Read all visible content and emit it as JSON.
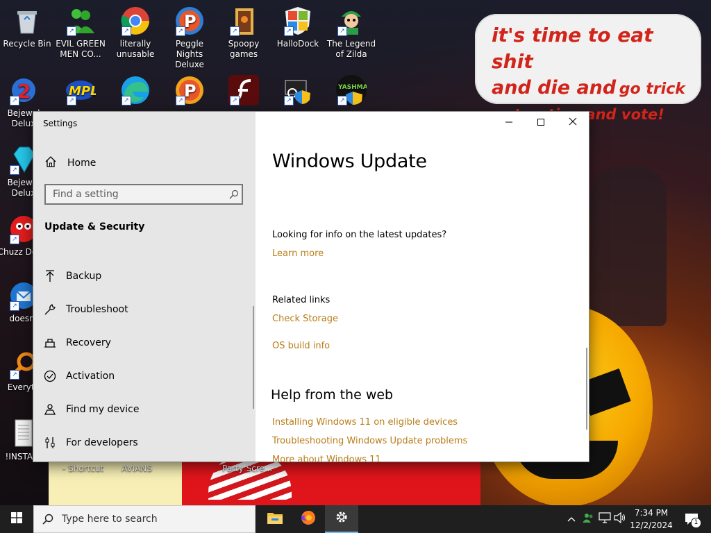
{
  "desktop": {
    "wallpaper_text": {
      "line1": "it's time to eat shit",
      "line2a": "and die and",
      "line2b": "go trick",
      "line3": "or treating and vote!"
    },
    "icons": [
      {
        "label": "Recycle Bin"
      },
      {
        "label": "EVIL GREEN MEN CO..."
      },
      {
        "label": "literally unusable"
      },
      {
        "label": "Peggle Nights Deluxe"
      },
      {
        "label": "Spoopy games"
      },
      {
        "label": "HalloDock"
      },
      {
        "label": "The Legend of Zilda"
      },
      {
        "label": "Bejewel Delux"
      },
      {
        "label": "Bejewel Delux"
      },
      {
        "label": "Chuzz Delux"
      },
      {
        "label": "doesnt"
      },
      {
        "label": "Everyth"
      },
      {
        "label": "!INSTALL"
      },
      {
        "label": "YASHMA"
      }
    ],
    "partial_labels": {
      "shortcut": "- Shortcut",
      "avians": "AVIANS",
      "party": "Party Scre..."
    }
  },
  "window": {
    "title": "Settings",
    "sidebar": {
      "home": "Home",
      "search_placeholder": "Find a setting",
      "section": "Update & Security",
      "items": [
        {
          "label": "Backup",
          "icon": "backup-arrow-icon"
        },
        {
          "label": "Troubleshoot",
          "icon": "wrench-icon"
        },
        {
          "label": "Recovery",
          "icon": "recovery-icon"
        },
        {
          "label": "Activation",
          "icon": "check-circle-icon"
        },
        {
          "label": "Find my device",
          "icon": "person-pin-icon"
        },
        {
          "label": "For developers",
          "icon": "developer-sliders-icon"
        }
      ]
    },
    "content": {
      "title": "Windows Update",
      "info_question": "Looking for info on the latest updates?",
      "learn_more": "Learn more",
      "related_links": "Related links",
      "check_storage": "Check Storage",
      "os_build_info": "OS build info",
      "help_heading": "Help from the web",
      "help_links": [
        "Installing Windows 11 on eligible devices",
        "Troubleshooting Windows Update problems",
        "More about Windows 11"
      ]
    }
  },
  "taskbar": {
    "search_placeholder": "Type here to search",
    "clock_time": "7:34 PM",
    "clock_date": "12/2/2024",
    "notification_count": "1"
  },
  "colors": {
    "link": "#b97d18",
    "sidebar_bg": "#e6e6e6",
    "taskbar_bg": "#1f1f1f",
    "accent": "#76b9ed"
  }
}
